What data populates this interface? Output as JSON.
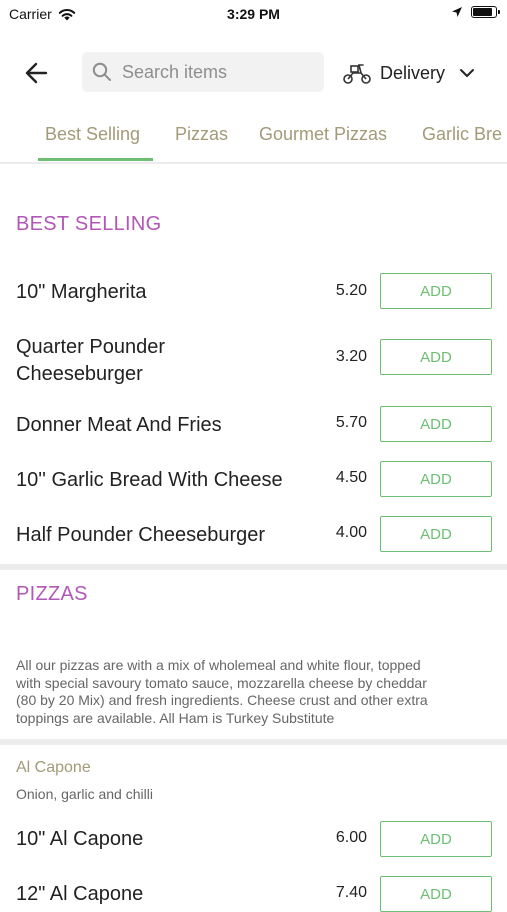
{
  "status_bar": {
    "carrier": "Carrier",
    "time": "3:29 PM",
    "battery_level": 0.9
  },
  "header": {
    "search_placeholder": "Search items",
    "delivery_label": "Delivery"
  },
  "tabs": [
    {
      "label": "Best Selling",
      "active": true
    },
    {
      "label": "Pizzas",
      "active": false
    },
    {
      "label": "Gourmet Pizzas",
      "active": false
    },
    {
      "label": "Garlic Bre",
      "active": false
    }
  ],
  "best_selling": {
    "title": "BEST SELLING",
    "items": [
      {
        "name": "10\" Margherita",
        "price": "5.20",
        "action": "ADD"
      },
      {
        "name_line1": "Quarter Pounder",
        "name_line2": "Cheeseburger",
        "price": "3.20",
        "action": "ADD"
      },
      {
        "name": "Donner Meat And Fries",
        "price": "5.70",
        "action": "ADD"
      },
      {
        "name": "10'' Garlic Bread With Cheese",
        "price": "4.50",
        "action": "ADD"
      },
      {
        "name": "Half Pounder Cheeseburger",
        "price": "4.00",
        "action": "ADD"
      }
    ]
  },
  "pizzas": {
    "title": "PIZZAS",
    "description_lines": [
      "All our pizzas are with a mix of wholemeal and white flour, topped",
      "with special savoury tomato sauce, mozzarella cheese by cheddar",
      "(80 by 20 Mix) and fresh ingredients. Cheese crust and other extra",
      "toppings are available. All Ham is Turkey Substitute"
    ],
    "group": {
      "title": "Al Capone",
      "description": "Onion, garlic and chilli",
      "items": [
        {
          "name": "10\" Al Capone",
          "price": "6.00",
          "action": "ADD"
        },
        {
          "name": "12\" Al Capone",
          "price": "7.40",
          "action": "ADD"
        }
      ]
    }
  },
  "colors": {
    "accent_green": "#6cbf72",
    "section_purple": "#b257b7",
    "tab_text": "#a39a78"
  }
}
